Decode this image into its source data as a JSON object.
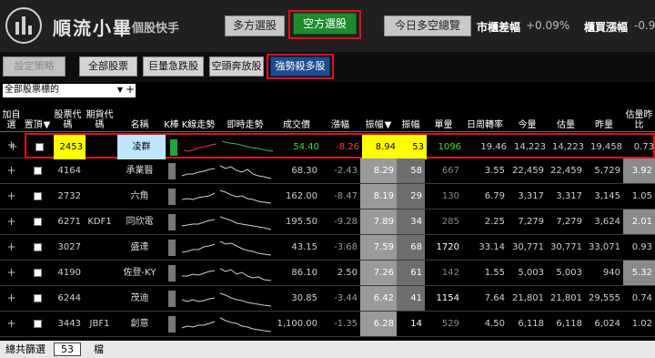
{
  "header": {
    "brand": "順流小畢",
    "brand_sub": "個股快手",
    "btn_long": "多方選股",
    "btn_short": "空方選股",
    "btn_overview": "今日多空總覽",
    "mkt_diff_label": "市櫃差幅",
    "mkt_diff_value": "+0.09%",
    "mkt_rise_label": "櫃買漲幅",
    "mkt_rise_value": "-0.9"
  },
  "toolbar": {
    "set_strategy": "設定策略",
    "all_stocks": "全部股票",
    "big_drop": "巨量急跌股",
    "short_run": "空頭奔放股",
    "strong_short": "強勢殺多股"
  },
  "filter": {
    "dropdown_value": "全部股票標的",
    "add_icon": "+"
  },
  "columns": [
    "加自選",
    "置頂",
    "股票代碼",
    "期貨代碼",
    "名稱",
    "K棒",
    "K線走勢",
    "即時走勢",
    "成交價",
    "漲幅",
    "振幅",
    "振幅",
    "單量",
    "日周轉率",
    "今量",
    "估量",
    "昨量",
    "估量昨比"
  ],
  "sort_indicator": "▼",
  "rows": [
    {
      "code": "2453",
      "fut": "",
      "name": "凌群",
      "price": "54.40",
      "chg": "-8.26",
      "amp": "8.94",
      "amp2": "53",
      "vol": "1096",
      "turn": "19.46",
      "today": "14,223",
      "est": "14,223",
      "yest": "19,458",
      "ratio": "0.73"
    },
    {
      "code": "4164",
      "fut": "",
      "name": "承業醫",
      "price": "68.30",
      "chg": "-2.43",
      "amp": "8.29",
      "amp2": "58",
      "vol": "667",
      "turn": "3.55",
      "today": "22,459",
      "est": "22,459",
      "yest": "5,729",
      "ratio": "3.92"
    },
    {
      "code": "2732",
      "fut": "",
      "name": "六角",
      "price": "162.00",
      "chg": "-8.47",
      "amp": "8.19",
      "amp2": "29",
      "vol": "130",
      "turn": "6.79",
      "today": "3,317",
      "est": "3,317",
      "yest": "3,145",
      "ratio": "1.05"
    },
    {
      "code": "6271",
      "fut": "KDF1",
      "name": "同欣電",
      "price": "195.50",
      "chg": "-9.28",
      "amp": "7.89",
      "amp2": "34",
      "vol": "285",
      "turn": "2.25",
      "today": "7,279",
      "est": "7,279",
      "yest": "3,624",
      "ratio": "2.01"
    },
    {
      "code": "3027",
      "fut": "",
      "name": "盛達",
      "price": "43.15",
      "chg": "-3.68",
      "amp": "7.59",
      "amp2": "68",
      "vol": "1720",
      "turn": "33.14",
      "today": "30,771",
      "est": "30,771",
      "yest": "33,071",
      "ratio": "0.93"
    },
    {
      "code": "4190",
      "fut": "",
      "name": "佐登-KY",
      "price": "86.10",
      "chg": "2.50",
      "amp": "7.26",
      "amp2": "61",
      "vol": "142",
      "turn": "1.55",
      "today": "5,003",
      "est": "5,003",
      "yest": "940",
      "ratio": "5.32"
    },
    {
      "code": "6244",
      "fut": "",
      "name": "茂迪",
      "price": "30.85",
      "chg": "-3.44",
      "amp": "6.42",
      "amp2": "41",
      "vol": "1154",
      "turn": "7.64",
      "today": "21,801",
      "est": "21,801",
      "yest": "29,555",
      "ratio": "0.74"
    },
    {
      "code": "3443",
      "fut": "JBF1",
      "name": "創意",
      "price": "1,100.00",
      "chg": "-1.35",
      "amp": "6.28",
      "amp2": "14",
      "vol": "529",
      "turn": "4.50",
      "today": "6,118",
      "est": "6,118",
      "yest": "6,024",
      "ratio": "1.02"
    }
  ],
  "footer": {
    "label": "總共篩選",
    "count": "53",
    "unit": "檔"
  },
  "colors": {
    "accent_red": "#e0101c",
    "short_green": "#1f8a2e",
    "strong_blue": "#1d4e8f",
    "sel_yellow": "#ffff00"
  }
}
